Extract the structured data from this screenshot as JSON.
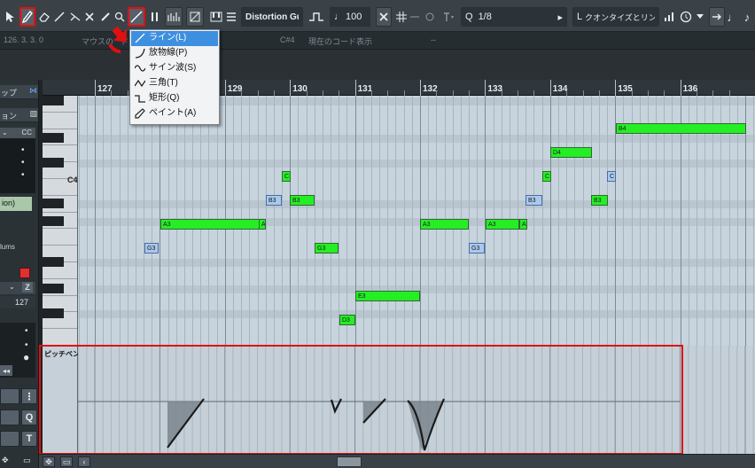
{
  "toolbar": {
    "sound_name": "Distortion Gu",
    "velocity": "100",
    "quantize": "1/8",
    "quantize_prefix": "Q",
    "chord_mode": "クオンタイズとリン",
    "draw_mode_label": "L"
  },
  "infobar": {
    "position": "126. 3. 3.   0",
    "mouse_label": "マウスの",
    "mouse_suffix": "ド",
    "note_value": "C#4",
    "chord_display": "現在のコード表示",
    "chord_value": "--"
  },
  "inspector": {
    "tab_label": "ップ",
    "section_label": "ョン",
    "cc_label": "CC",
    "row_label": "ion)",
    "column_label": "lums",
    "value": "127",
    "z_label": "Z",
    "q_label": "Q",
    "t_label": "T"
  },
  "ruler": {
    "bars": [
      "127",
      "128",
      "129",
      "130",
      "131",
      "132",
      "133",
      "134",
      "135",
      "136"
    ]
  },
  "piano": {
    "c4_label": "C4"
  },
  "notes": [
    {
      "label": "A3",
      "color": "green"
    },
    {
      "label": "A",
      "color": "green"
    },
    {
      "label": "G3",
      "color": "blue"
    },
    {
      "label": "B3",
      "color": "blue"
    },
    {
      "label": "C",
      "color": "green"
    },
    {
      "label": "B3",
      "color": "green"
    },
    {
      "label": "G3",
      "color": "green"
    },
    {
      "label": "E3",
      "color": "green"
    },
    {
      "label": "D3",
      "color": "green"
    },
    {
      "label": "A3",
      "color": "green"
    },
    {
      "label": "G3",
      "color": "blue"
    },
    {
      "label": "A3",
      "color": "green"
    },
    {
      "label": "A",
      "color": "green"
    },
    {
      "label": "B3",
      "color": "blue"
    },
    {
      "label": "C",
      "color": "green"
    },
    {
      "label": "D4",
      "color": "green"
    },
    {
      "label": "B3",
      "color": "green"
    },
    {
      "label": "C",
      "color": "blue"
    },
    {
      "label": "B4",
      "color": "green"
    }
  ],
  "pitchbend": {
    "lane_label": "ピッチベンド"
  },
  "menu": {
    "items": [
      {
        "label": "ライン(L)",
        "active": true
      },
      {
        "label": "放物線(P)",
        "active": false
      },
      {
        "label": "サイン波(S)",
        "active": false
      },
      {
        "label": "三角(T)",
        "active": false
      },
      {
        "label": "矩形(Q)",
        "active": false
      },
      {
        "label": "ペイント(A)",
        "active": false
      }
    ]
  },
  "colors": {
    "highlight": "#e01010",
    "note_green": "#25ee25",
    "note_blue": "#a9c8ee",
    "menu_active": "#3d8fe0"
  }
}
